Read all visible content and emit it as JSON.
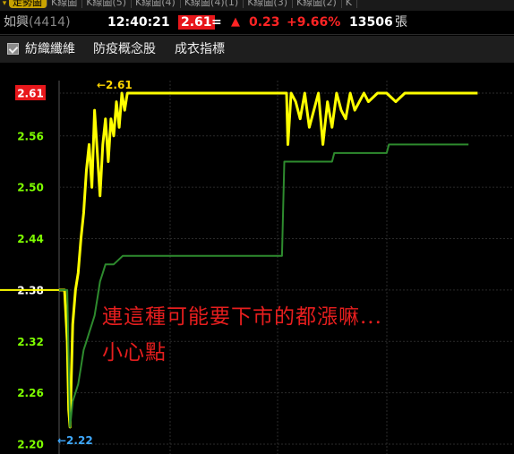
{
  "tabs": [
    {
      "label": "走勢圖",
      "active": true
    },
    {
      "label": "K線圖",
      "active": false
    },
    {
      "label": "K線圖(5)",
      "active": false
    },
    {
      "label": "K線圖(4)",
      "active": false
    },
    {
      "label": "K線圖(4)(1)",
      "active": false
    },
    {
      "label": "K線圖(3)",
      "active": false
    },
    {
      "label": "K線圖(2)",
      "active": false
    },
    {
      "label": "K",
      "active": false
    }
  ],
  "quote": {
    "name": "如興",
    "code": "(4414)",
    "time": "12:40:21",
    "price": "2.61",
    "eq": "=",
    "arrow": "▲",
    "change": "0.23",
    "percent": "+9.66%",
    "volume": "13506",
    "unit": "張"
  },
  "concepts": [
    "紡織纖維",
    "防疫概念股",
    "成衣指標"
  ],
  "colors": {
    "price_line": "#ffff00",
    "avg_line": "#2e8b2e",
    "up": "#ff2424",
    "axis_label": "#7fff00",
    "overlay_text": "#e61e1e"
  },
  "chart_data": {
    "type": "line",
    "ylim": [
      2.2,
      2.63
    ],
    "ref_price": 2.38,
    "yticks": [
      "2.61",
      "2.56",
      "2.50",
      "2.44",
      "2.38",
      "2.32",
      "2.26",
      "2.20"
    ],
    "high_label": "←2.61",
    "low_label": "←2.22",
    "series": [
      {
        "x": [
          0,
          1.2,
          1.8,
          2.1,
          2.4,
          2.7,
          3,
          3.6,
          4.2,
          4.8,
          5.4,
          6,
          6.6,
          7.2,
          7.8,
          8.4,
          9,
          9.6,
          10.2,
          10.8,
          11.4,
          12,
          12.6,
          13.2,
          13.8,
          14.4,
          15,
          16,
          18,
          30,
          45,
          50,
          50.3,
          51,
          52,
          53,
          54,
          55,
          56,
          57,
          58,
          59,
          60,
          61,
          62,
          63,
          64,
          65,
          66,
          67,
          68,
          70,
          72,
          74,
          76,
          80,
          85,
          90,
          92
        ],
        "y": [
          2.38,
          2.38,
          2.32,
          2.24,
          2.22,
          2.28,
          2.34,
          2.38,
          2.4,
          2.44,
          2.47,
          2.52,
          2.55,
          2.5,
          2.59,
          2.54,
          2.49,
          2.55,
          2.58,
          2.53,
          2.58,
          2.56,
          2.6,
          2.57,
          2.61,
          2.59,
          2.61,
          2.61,
          2.61,
          2.61,
          2.61,
          2.61,
          2.55,
          2.61,
          2.6,
          2.58,
          2.61,
          2.57,
          2.59,
          2.61,
          2.55,
          2.6,
          2.57,
          2.61,
          2.59,
          2.58,
          2.61,
          2.59,
          2.6,
          2.61,
          2.6,
          2.61,
          2.61,
          2.6,
          2.61,
          2.61,
          2.61,
          2.61,
          2.61
        ]
      },
      {
        "x": [
          0,
          1.8,
          2.4,
          3,
          3.6,
          4.2,
          4.8,
          5.4,
          6,
          6.6,
          7.2,
          7.8,
          8.4,
          9,
          9.6,
          10.2,
          10.8,
          12,
          14,
          16,
          20,
          25,
          30,
          40,
          45,
          49,
          49.5,
          55,
          60,
          60.5,
          70,
          72,
          72.5,
          90
        ],
        "y": [
          2.38,
          2.38,
          2.22,
          2.25,
          2.26,
          2.27,
          2.29,
          2.31,
          2.32,
          2.33,
          2.34,
          2.35,
          2.37,
          2.39,
          2.4,
          2.41,
          2.41,
          2.41,
          2.42,
          2.42,
          2.42,
          2.42,
          2.42,
          2.42,
          2.42,
          2.42,
          2.53,
          2.53,
          2.53,
          2.54,
          2.54,
          2.54,
          2.55,
          2.55
        ]
      }
    ],
    "xlim": [
      0,
      100
    ]
  },
  "overlay": {
    "line1": "連這種可能要下市的都漲嘛...",
    "line2": "小心點"
  }
}
